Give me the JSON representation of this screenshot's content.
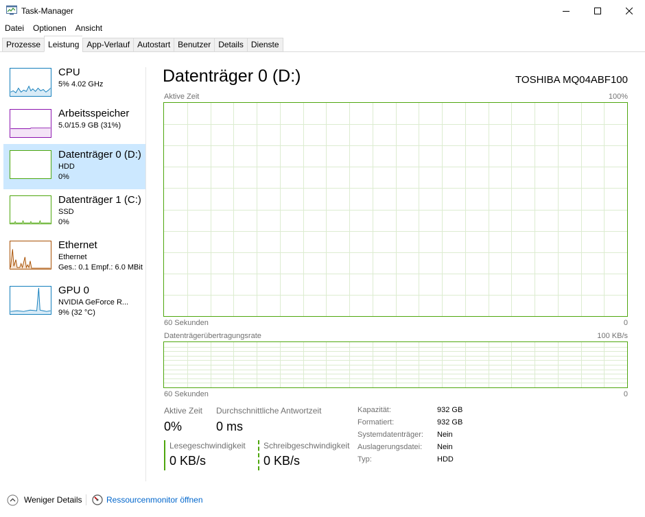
{
  "window": {
    "title": "Task-Manager",
    "icon": "task-manager-icon"
  },
  "menu": [
    "Datei",
    "Optionen",
    "Ansicht"
  ],
  "tabs": [
    "Prozesse",
    "Leistung",
    "App-Verlauf",
    "Autostart",
    "Benutzer",
    "Details",
    "Dienste"
  ],
  "active_tab": "Leistung",
  "resources": [
    {
      "name": "CPU",
      "line1": "5% 4.02 GHz",
      "line2": "",
      "color": "#117dbb"
    },
    {
      "name": "Arbeitsspeicher",
      "line1": "5.0/15.9 GB (31%)",
      "line2": "",
      "color": "#8b12ae"
    },
    {
      "name": "Datenträger 0 (D:)",
      "line1": "HDD",
      "line2": "0%",
      "color": "#4da60c"
    },
    {
      "name": "Datenträger 1 (C:)",
      "line1": "SSD",
      "line2": "0%",
      "color": "#4da60c"
    },
    {
      "name": "Ethernet",
      "line1": "Ethernet",
      "line2": "Ges.: 0.1 Empf.: 6.0 MBit",
      "color": "#a74f01"
    },
    {
      "name": "GPU 0",
      "line1": "NVIDIA GeForce R...",
      "line2": "9% (32 °C)",
      "color": "#117dbb"
    }
  ],
  "selected_resource": "Datenträger 0 (D:)",
  "main": {
    "title": "Datenträger 0 (D:)",
    "device": "TOSHIBA MQ04ABF100",
    "graph1": {
      "label": "Aktive Zeit",
      "max": "100%",
      "time": "60 Sekunden",
      "min": "0"
    },
    "graph2": {
      "label": "Datenträgerübertragungsrate",
      "max": "100 KB/s",
      "time": "60 Sekunden",
      "min": "0"
    },
    "stats": {
      "active_time_label": "Aktive Zeit",
      "active_time_value": "0%",
      "response_label": "Durchschnittliche Antwortzeit",
      "response_value": "0 ms",
      "read_label": "Lesegeschwindigkeit",
      "read_value": "0 KB/s",
      "write_label": "Schreibgeschwindigkeit",
      "write_value": "0 KB/s"
    },
    "properties": [
      {
        "label": "Kapazität:",
        "value": "932 GB"
      },
      {
        "label": "Formatiert:",
        "value": "932 GB"
      },
      {
        "label": "Systemdatenträger:",
        "value": "Nein"
      },
      {
        "label": "Auslagerungsdatei:",
        "value": "Nein"
      },
      {
        "label": "Typ:",
        "value": "HDD"
      }
    ]
  },
  "footer": {
    "less_details": "Weniger Details",
    "resource_monitor": "Ressourcenmonitor öffnen"
  },
  "colors": {
    "disk_green": "#4da60c",
    "selected_bg": "#cce8ff",
    "link_blue": "#0066cc"
  }
}
